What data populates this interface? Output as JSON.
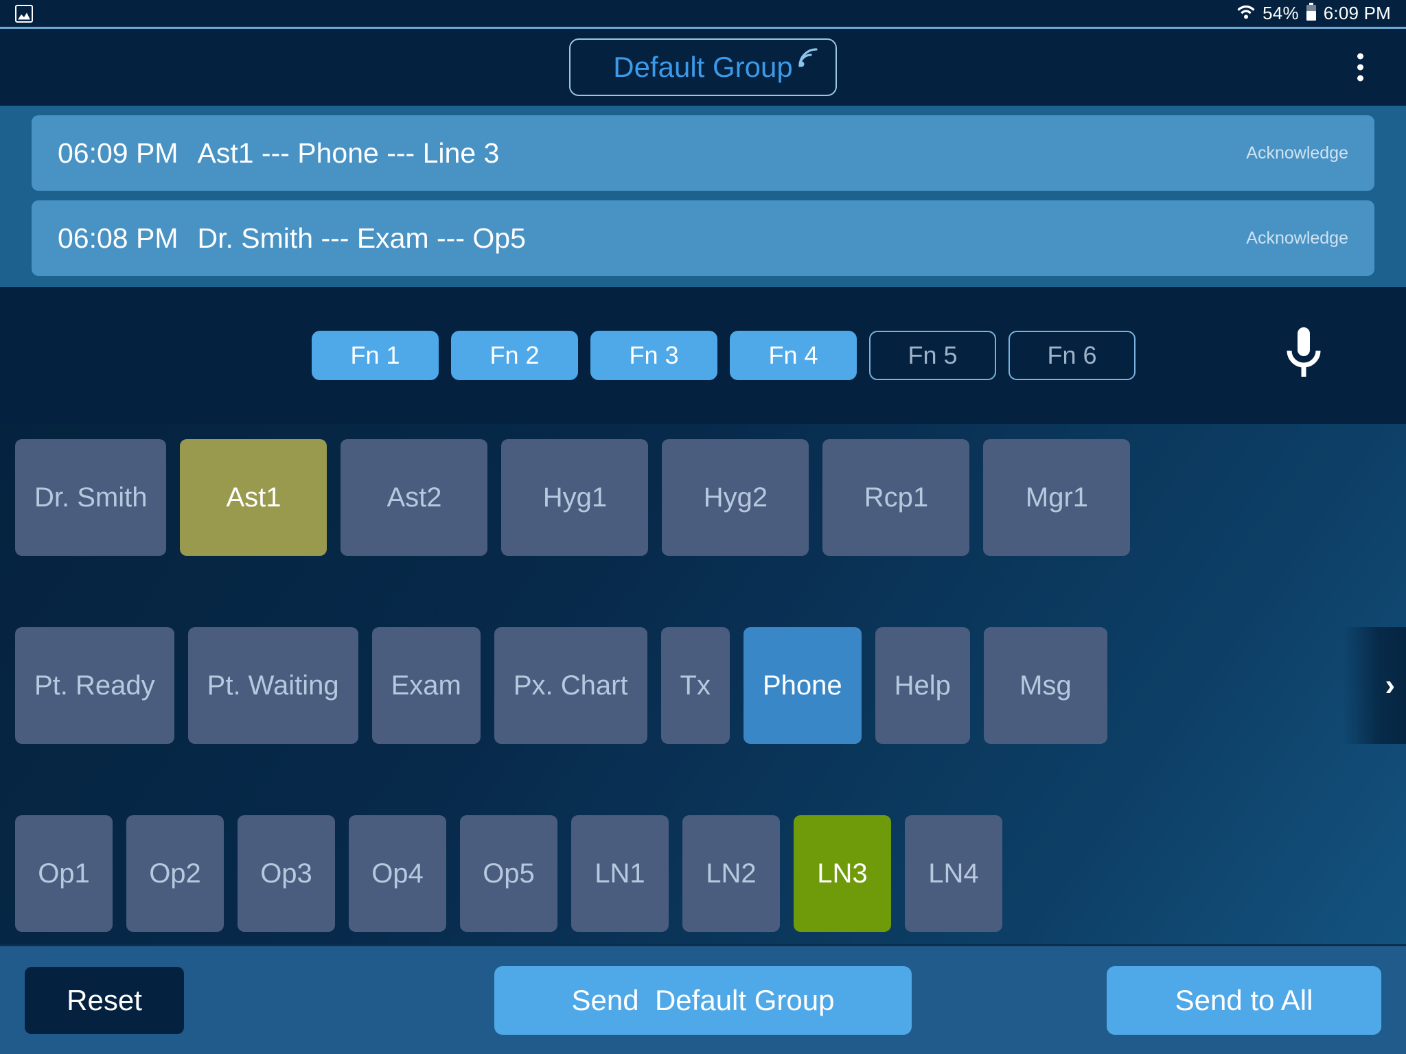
{
  "status_bar": {
    "photo_icon": "image-icon",
    "wifi_icon": "wifi-icon",
    "battery_percent": "54%",
    "battery_icon": "battery-icon",
    "time": "6:09 PM"
  },
  "header": {
    "group_label": "Default Group",
    "group_signal_icon": "wifi-signal-icon",
    "overflow_icon": "more-vertical-icon",
    "accent_color": "#3c9ae8",
    "border_color": "#9dc6e6"
  },
  "alerts": [
    {
      "time": "06:09 PM",
      "message": "Ast1 --- Phone --- Line 3",
      "action": "Acknowledge"
    },
    {
      "time": "06:08 PM",
      "message": "Dr. Smith --- Exam --- Op5",
      "action": "Acknowledge"
    }
  ],
  "function_bar": {
    "buttons": [
      {
        "label": "Fn 1",
        "active": true
      },
      {
        "label": "Fn 2",
        "active": true
      },
      {
        "label": "Fn 3",
        "active": true
      },
      {
        "label": "Fn 4",
        "active": true
      },
      {
        "label": "Fn 5",
        "active": false
      },
      {
        "label": "Fn 6",
        "active": false
      }
    ],
    "mic_icon": "microphone-icon",
    "active_color": "#4fa9e8",
    "inactive_text_color": "#9fb4c9"
  },
  "keypad": {
    "row_people": [
      {
        "label": "Dr. Smith",
        "state": "off"
      },
      {
        "label": "Ast1",
        "state": "olive"
      },
      {
        "label": "Ast2",
        "state": "off"
      },
      {
        "label": "Hyg1",
        "state": "off"
      },
      {
        "label": "Hyg2",
        "state": "off"
      },
      {
        "label": "Rcp1",
        "state": "off"
      },
      {
        "label": "Mgr1",
        "state": "off"
      }
    ],
    "row_actions": [
      {
        "label": "Pt. Ready",
        "state": "off"
      },
      {
        "label": "Pt. Waiting",
        "state": "off"
      },
      {
        "label": "Exam",
        "state": "off"
      },
      {
        "label": "Px. Chart",
        "state": "off"
      },
      {
        "label": "Tx",
        "state": "off"
      },
      {
        "label": "Phone",
        "state": "blue"
      },
      {
        "label": "Help",
        "state": "off"
      },
      {
        "label": "Msg",
        "state": "off"
      }
    ],
    "row_locations": [
      {
        "label": "Op1",
        "state": "off"
      },
      {
        "label": "Op2",
        "state": "off"
      },
      {
        "label": "Op3",
        "state": "off"
      },
      {
        "label": "Op4",
        "state": "off"
      },
      {
        "label": "Op5",
        "state": "off"
      },
      {
        "label": "LN1",
        "state": "off"
      },
      {
        "label": "LN2",
        "state": "off"
      },
      {
        "label": "LN3",
        "state": "green"
      },
      {
        "label": "LN4",
        "state": "off"
      }
    ],
    "scroll_chevron": "chevron-right-icon",
    "colors": {
      "key_off": "#4a5d7e",
      "key_selected_blue": "#3a87c8",
      "key_selected_olive": "#9a9a4e",
      "key_selected_green": "#6f9a09"
    }
  },
  "bottom_bar": {
    "reset_label": "Reset",
    "send_group_label": "Send  Default Group",
    "send_all_label": "Send to All",
    "bar_color": "#215b8c",
    "send_color": "#4fa9e8"
  }
}
